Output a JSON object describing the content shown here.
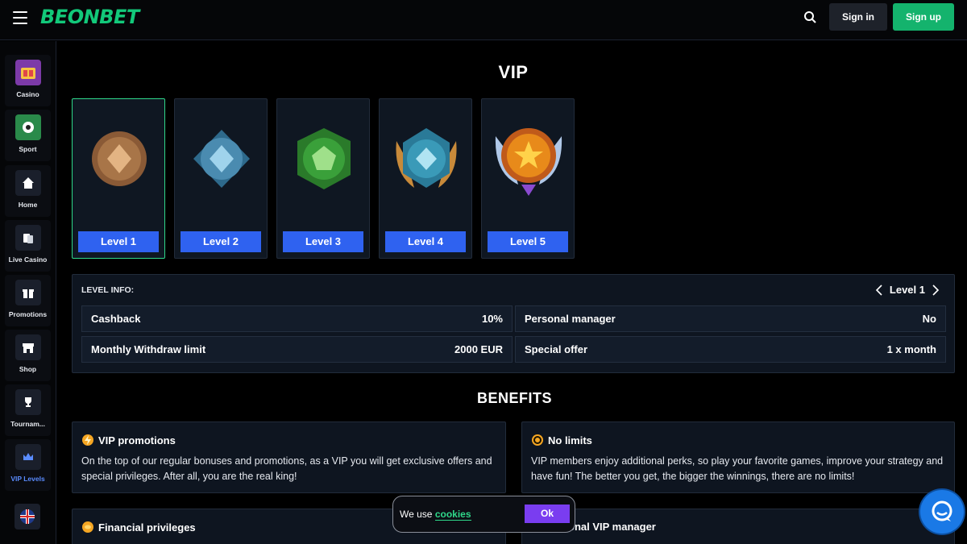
{
  "header": {
    "logo": "BEONBET",
    "signin_label": "Sign in",
    "signup_label": "Sign up",
    "icons": [
      "menu-icon",
      "search-icon"
    ]
  },
  "sidebar": {
    "items": [
      {
        "label": "Casino",
        "icon": "casino-icon"
      },
      {
        "label": "Sport",
        "icon": "sport-icon"
      },
      {
        "label": "Home",
        "icon": "home-icon"
      },
      {
        "label": "Live Casino",
        "icon": "live-casino-icon"
      },
      {
        "label": "Promotions",
        "icon": "gift-icon"
      },
      {
        "label": "Shop",
        "icon": "shop-icon"
      },
      {
        "label": "Tournam...",
        "icon": "trophy-icon"
      },
      {
        "label": "VIP Levels",
        "icon": "crown-icon"
      }
    ],
    "language_icon": "uk-flag-icon"
  },
  "main": {
    "title": "VIP",
    "levels": [
      {
        "label": "Level 1",
        "color": "#a87548"
      },
      {
        "label": "Level 2",
        "color": "#4a8bb0"
      },
      {
        "label": "Level 3",
        "color": "#3aa03a"
      },
      {
        "label": "Level 4",
        "color": "#3a9ab8"
      },
      {
        "label": "Level 5",
        "color": "#e88a1a"
      }
    ],
    "selected_level": "Level 1",
    "level_info": {
      "title": "LEVEL INFO:",
      "current": "Level 1",
      "rows": [
        {
          "label": "Cashback",
          "value": "10%"
        },
        {
          "label": "Personal manager",
          "value": "No"
        },
        {
          "label": "Monthly Withdraw limit",
          "value": "2000 EUR"
        },
        {
          "label": "Special offer",
          "value": "1 x month"
        }
      ]
    },
    "benefits_title": "BENEFITS",
    "benefits": [
      {
        "title": "VIP promotions",
        "icon": "lightning-icon",
        "text": "On the top of our regular bonuses and promotions, as a VIP you will get exclusive offers and special privileges. After all, you are the real king!"
      },
      {
        "title": "No limits",
        "icon": "coin-icon",
        "text": "VIP members enjoy additional perks, so play your favorite games, improve your strategy and have fun! The better you get, the bigger the winnings, there are no limits!"
      },
      {
        "title": "Financial privileges",
        "icon": "coin-stack-icon",
        "text": ""
      },
      {
        "title": "onal VIP manager",
        "icon": "manager-icon",
        "text": ""
      }
    ]
  },
  "cookie": {
    "text": "We use",
    "link": "cookies",
    "ok_label": "Ok"
  },
  "colors": {
    "brand": "#12c97a",
    "accent_blue": "#2f62f0",
    "cookie_ok": "#7a3df0",
    "chat": "#1a79e6"
  }
}
